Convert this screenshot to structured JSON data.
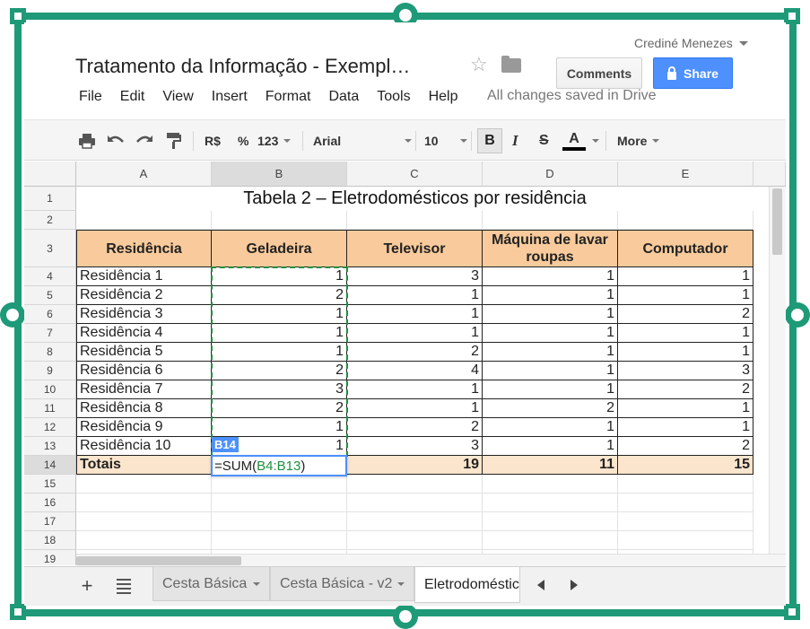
{
  "header": {
    "user_name": "Crediné Menezes",
    "doc_title": "Tratamento da Informação - Exempl…",
    "comments_label": "Comments",
    "share_label": "Share",
    "save_status": "All changes saved in Drive"
  },
  "menu": [
    "File",
    "Edit",
    "View",
    "Insert",
    "Format",
    "Data",
    "Tools",
    "Help"
  ],
  "toolbar": {
    "currency": "R$",
    "percent": "%",
    "number_format": "123",
    "font": "Arial",
    "font_size": "10",
    "bold": "B",
    "italic": "I",
    "strike": "S",
    "text_color": "A",
    "more": "More"
  },
  "columns": [
    "A",
    "B",
    "C",
    "D",
    "E"
  ],
  "rows": [
    "1",
    "2",
    "3",
    "4",
    "5",
    "6",
    "7",
    "8",
    "9",
    "10",
    "11",
    "12",
    "13",
    "14",
    "15",
    "16",
    "17",
    "18",
    "19"
  ],
  "sheet": {
    "title": "Tabela 2 – Eletrodomésticos por residência",
    "headers": [
      "Residência",
      "Geladeira",
      "Televisor",
      "Máquina de lavar roupas",
      "Computador"
    ],
    "data": [
      [
        "Residência 1",
        "1",
        "3",
        "1",
        "1"
      ],
      [
        "Residência 2",
        "2",
        "1",
        "1",
        "1"
      ],
      [
        "Residência 3",
        "1",
        "1",
        "1",
        "2"
      ],
      [
        "Residência 4",
        "1",
        "1",
        "1",
        "1"
      ],
      [
        "Residência 5",
        "1",
        "2",
        "1",
        "1"
      ],
      [
        "Residência 6",
        "2",
        "4",
        "1",
        "3"
      ],
      [
        "Residência 7",
        "3",
        "1",
        "1",
        "2"
      ],
      [
        "Residência 8",
        "2",
        "1",
        "2",
        "1"
      ],
      [
        "Residência 9",
        "1",
        "2",
        "1",
        "1"
      ],
      [
        "Residência 10",
        "1",
        "3",
        "1",
        "2"
      ]
    ],
    "totals_label": "Totais",
    "totals": [
      "",
      "19",
      "11",
      "15"
    ],
    "editing_ref": "B14",
    "formula_prefix": "=SUM(",
    "formula_range": "B4:B13",
    "formula_suffix": ")"
  },
  "tabs": [
    "Cesta Básica",
    "Cesta Básica - v2",
    "Eletrodoméstic"
  ],
  "colors": {
    "frame": "#1e9a78",
    "header_fill": "#f9cb9c",
    "totals_fill": "#fce5cd",
    "share_button": "#4d90fe",
    "range_highlight": "#1e8f3e"
  }
}
